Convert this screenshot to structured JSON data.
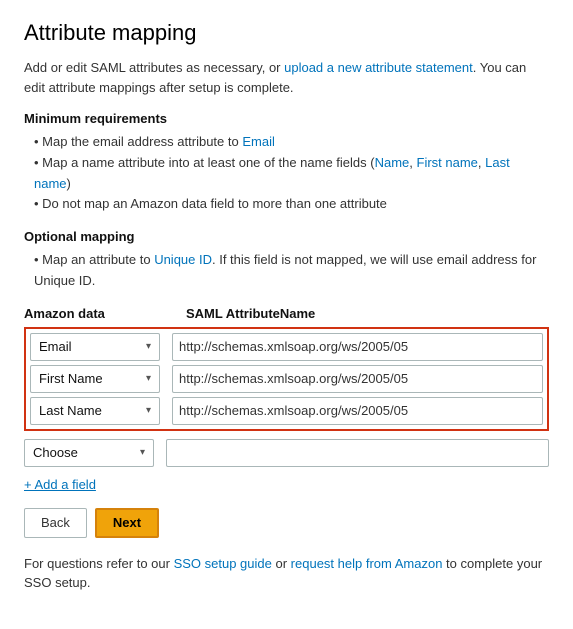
{
  "page": {
    "title": "Attribute mapping",
    "intro_text": "Add or edit SAML attributes as necessary, or ",
    "intro_link1_label": "upload a new attribute statement",
    "intro_after_link1": ". You can edit attribute mappings after setup is complete.",
    "minimum_requirements_title": "Minimum requirements",
    "min_req_items": [
      "Map the email address attribute to Email",
      "Map a name attribute into at least one of the name fields (Name, First name, Last name)",
      "Do not map an Amazon data field to more than one attribute"
    ],
    "optional_mapping_title": "Optional mapping",
    "opt_map_items": [
      "Map an attribute to Unique ID. If this field is not mapped, we will use email address for Unique ID."
    ],
    "col_amazon_label": "Amazon data",
    "col_saml_label": "SAML AttributeName",
    "required_rows": [
      {
        "amazon_label": "Email",
        "saml_value": "http://schemas.xmlsoap.org/ws/2005/05"
      },
      {
        "amazon_label": "First Name",
        "saml_value": "http://schemas.xmlsoap.org/ws/2005/05"
      },
      {
        "amazon_label": "Last Name",
        "saml_value": "http://schemas.xmlsoap.org/ws/2005/05"
      }
    ],
    "optional_row": {
      "amazon_label": "Choose",
      "saml_value": ""
    },
    "add_field_label": "+ Add a field",
    "btn_back_label": "Back",
    "btn_next_label": "Next",
    "footer_text1": "For questions refer to our ",
    "footer_link1_label": "SSO setup guide",
    "footer_text2": " or ",
    "footer_link2_label": "request help from Amazon",
    "footer_text3": " to complete your SSO setup."
  }
}
